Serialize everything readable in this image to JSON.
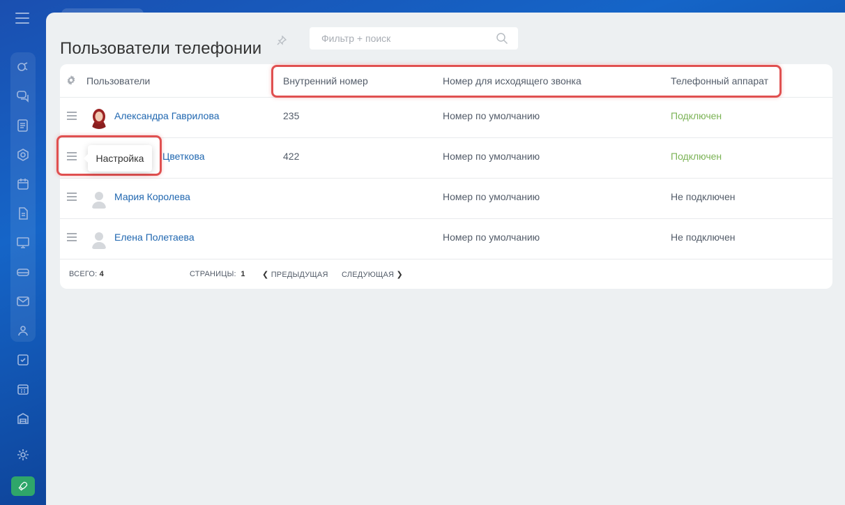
{
  "header": {
    "title": "Пользователи телефонии",
    "search_placeholder": "Фильтр + поиск"
  },
  "table": {
    "columns": [
      "Пользователи",
      "Внутренний номер",
      "Номер для исходящего звонка",
      "Телефонный аппарат"
    ],
    "rows": [
      {
        "name": "Александра Гаврилова",
        "ext": "235",
        "outgoing": "Номер по умолчанию",
        "device": "Подключен",
        "device_connected": true
      },
      {
        "name": "Цветкова",
        "ext": "422",
        "outgoing": "Номер по умолчанию",
        "device": "Подключен",
        "device_connected": true
      },
      {
        "name": "Мария Королева",
        "ext": "",
        "outgoing": "Номер по умолчанию",
        "device": "Не подключен",
        "device_connected": false
      },
      {
        "name": "Елена Полетаева",
        "ext": "",
        "outgoing": "Номер по умолчанию",
        "device": "Не подключен",
        "device_connected": false
      }
    ]
  },
  "footer": {
    "total_label": "ВСЕГО:",
    "total_value": "4",
    "pages_label": "СТРАНИЦЫ:",
    "pages_value": "1",
    "prev_label": "ПРЕДЫДУЩАЯ",
    "next_label": "СЛЕДУЮЩАЯ"
  },
  "tooltip": {
    "text": "Настройка"
  },
  "colors": {
    "accent": "#2067b0",
    "connected": "#7bb355",
    "highlight": "#e05050"
  },
  "icons": {
    "sidebar": [
      "menu-icon",
      "close-icon",
      "activity-icon",
      "chat-icon",
      "feed-icon",
      "crm-icon",
      "calendar-icon",
      "document-icon",
      "presentation-icon",
      "storage-icon",
      "mail-icon",
      "contacts-icon",
      "tasks-icon",
      "calendar-grid-icon",
      "warehouse-icon",
      "settings-icon",
      "rocket-icon"
    ]
  }
}
